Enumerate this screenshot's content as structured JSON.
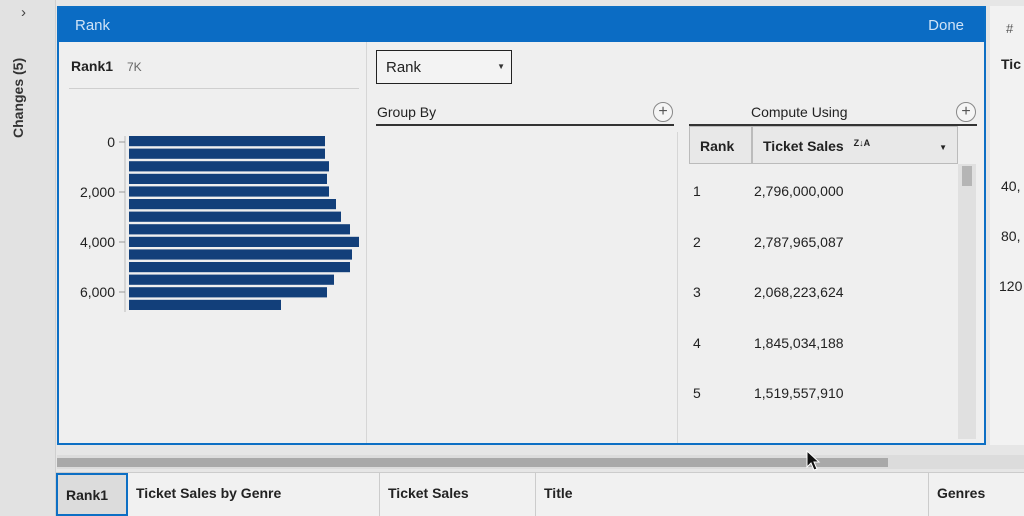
{
  "sidebar": {
    "collapse_glyph": "›",
    "changes_label": "Changes (5)"
  },
  "rank_panel": {
    "title": "Rank",
    "done_label": "Done",
    "profile": {
      "field_name": "Rank1",
      "count_label": "7K",
      "axis_ticks": [
        "0",
        "2,000",
        "4,000",
        "6,000"
      ],
      "bar_color": "#123f7a",
      "bar_values": [
        0.85,
        0.85,
        0.87,
        0.86,
        0.87,
        0.9,
        0.92,
        0.96,
        1.0,
        0.97,
        0.96,
        0.89,
        0.86,
        0.66
      ]
    },
    "rank_select": {
      "value": "Rank"
    },
    "group_by": {
      "label": "Group By"
    },
    "compute_using": {
      "label": "Compute Using",
      "columns": [
        {
          "label": "Rank"
        },
        {
          "label": "Ticket Sales"
        }
      ],
      "sort_icon": "Z↓A",
      "rows": [
        {
          "rank": "1",
          "sales": "2,796,000,000"
        },
        {
          "rank": "2",
          "sales": "2,787,965,087"
        },
        {
          "rank": "3",
          "sales": "2,068,223,624"
        },
        {
          "rank": "4",
          "sales": "1,845,034,188"
        },
        {
          "rank": "5",
          "sales": "1,519,557,910"
        }
      ]
    }
  },
  "right_peek": {
    "type_icon": "#",
    "header_text": "Tic",
    "values": [
      "40,",
      "80,",
      "120"
    ]
  },
  "data_grid": {
    "columns": [
      {
        "label": "Rank1",
        "selected": true
      },
      {
        "label": "Ticket Sales by Genre"
      },
      {
        "label": "Ticket Sales"
      },
      {
        "label": "Title"
      },
      {
        "label": "Genres"
      }
    ]
  },
  "accent_color": "#0b6cc4"
}
